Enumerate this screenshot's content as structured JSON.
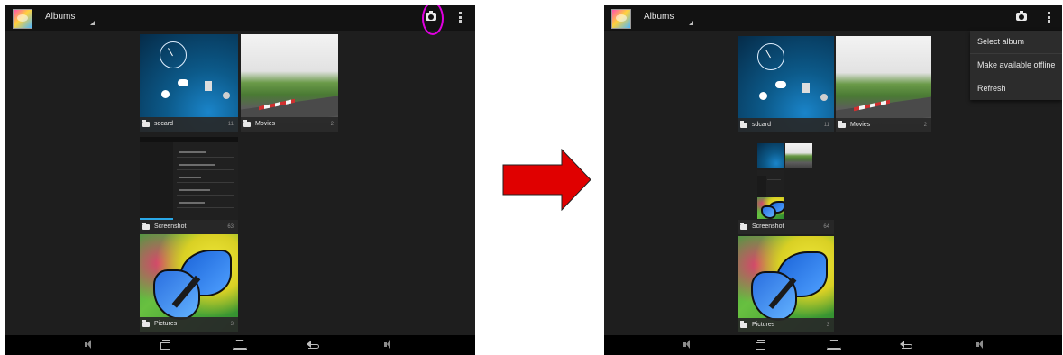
{
  "before": {
    "title": "Albums",
    "albums": [
      {
        "name": "sdcard",
        "count": "11"
      },
      {
        "name": "Movies",
        "count": "2"
      },
      {
        "name": "Screenshot",
        "count": "63"
      },
      {
        "name": "Pictures",
        "count": "3"
      }
    ]
  },
  "after": {
    "title": "Albums",
    "albums": [
      {
        "name": "sdcard",
        "count": "11"
      },
      {
        "name": "Movies",
        "count": "2"
      },
      {
        "name": "Screenshot",
        "count": "64"
      },
      {
        "name": "Pictures",
        "count": "3"
      }
    ],
    "menu": [
      "Select album",
      "Make available offline",
      "Refresh"
    ]
  },
  "colors": {
    "highlight": "#e000e0",
    "arrow": "#e00000"
  }
}
